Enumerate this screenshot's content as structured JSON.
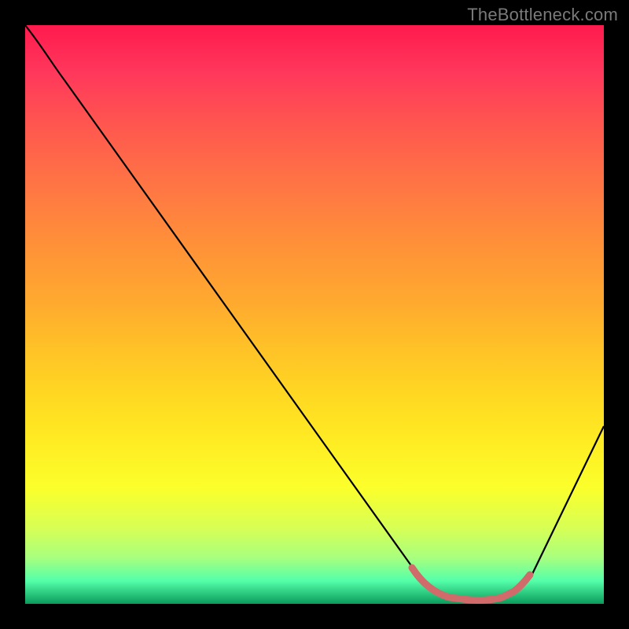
{
  "watermark": "TheBottleneck.com",
  "colors": {
    "background": "#000000",
    "curve": "#000000",
    "highlight": "#d16a6a",
    "gradient_top": "#ff1a4d",
    "gradient_mid": "#ffe030",
    "gradient_bottom": "#0a9c5c"
  },
  "chart_data": {
    "type": "line",
    "title": "",
    "xlabel": "",
    "ylabel": "",
    "xlim": [
      0,
      100
    ],
    "ylim": [
      0,
      100
    ],
    "x": [
      0,
      2,
      5,
      10,
      20,
      30,
      40,
      50,
      58,
      62,
      68,
      74,
      78,
      82,
      86,
      90,
      95,
      100
    ],
    "y": [
      100,
      98,
      94,
      87,
      73,
      59,
      45,
      31,
      19,
      12,
      4,
      0,
      0,
      0,
      1,
      8,
      18,
      31
    ],
    "highlight_range_x": [
      62,
      86
    ],
    "notes": "V-shaped bottleneck curve; valley (optimal region) flattened near y≈0 between x≈62–86; values estimated from pixel positions as no axes/ticks are shown."
  }
}
